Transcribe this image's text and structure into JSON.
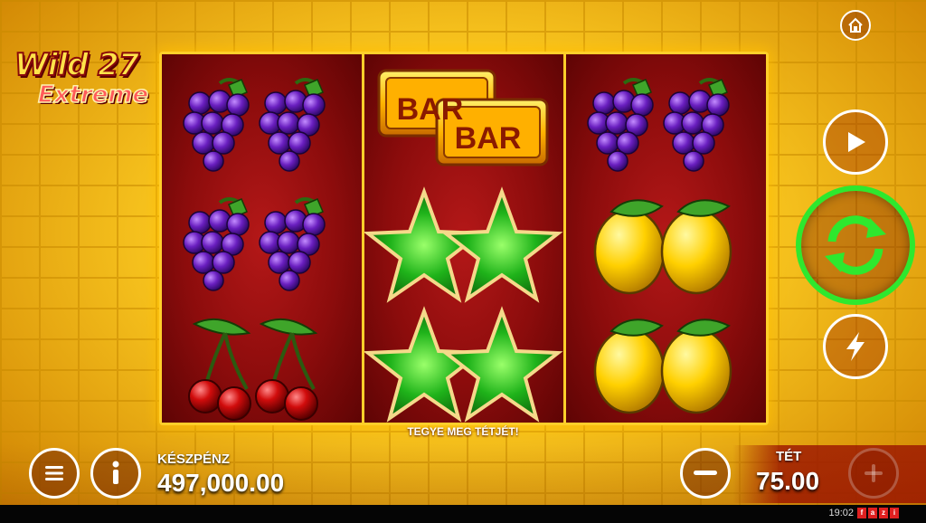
{
  "game": {
    "logo_line1": "Wild 27",
    "logo_line2": "Extreme"
  },
  "reels": [
    [
      "grapes-icon",
      "grapes-icon",
      "cherries-icon"
    ],
    [
      "bar-icon",
      "star-icon",
      "star-icon"
    ],
    [
      "grapes-icon",
      "lemon-icon",
      "lemon-icon"
    ]
  ],
  "message": "TEGYE MEG TÉTJÉT!",
  "balance": {
    "label": "KÉSZPÉNZ",
    "value": "497,000.00"
  },
  "bet": {
    "label": "TÉT",
    "value": "75.00"
  },
  "symbols": {
    "bar_text": "BAR"
  },
  "status": {
    "time": "19:02",
    "brand": "fazi"
  },
  "colors": {
    "frame": "#ffcf2a",
    "reel_bg": "#9a1010",
    "spin_ring": "#2ee82e"
  },
  "controls": [
    "home-icon",
    "play-icon",
    "spin-icon",
    "lightning-icon",
    "menu-icon",
    "info-icon",
    "minus-icon",
    "plus-icon"
  ]
}
